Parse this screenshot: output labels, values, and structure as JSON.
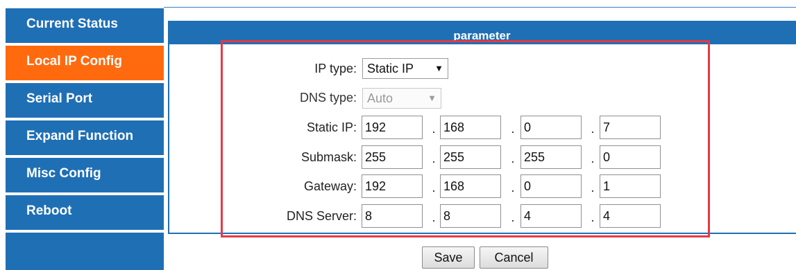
{
  "sidebar": {
    "items": [
      {
        "label": "Current Status"
      },
      {
        "label": "Local IP Config",
        "active": true
      },
      {
        "label": "Serial Port"
      },
      {
        "label": "Expand Function"
      },
      {
        "label": "Misc Config"
      },
      {
        "label": "Reboot"
      }
    ]
  },
  "panel": {
    "title": "parameter",
    "ip_type": {
      "label": "IP type:",
      "value": "Static IP"
    },
    "dns_type": {
      "label": "DNS type:",
      "value": "Auto",
      "disabled": true
    },
    "static_ip": {
      "label": "Static IP:",
      "octets": [
        "192",
        "168",
        "0",
        "7"
      ]
    },
    "submask": {
      "label": "Submask:",
      "octets": [
        "255",
        "255",
        "255",
        "0"
      ]
    },
    "gateway": {
      "label": "Gateway:",
      "octets": [
        "192",
        "168",
        "0",
        "1"
      ]
    },
    "dns_server": {
      "label": "DNS Server:",
      "octets": [
        "8",
        "8",
        "4",
        "4"
      ]
    }
  },
  "actions": {
    "save_label": "Save",
    "cancel_label": "Cancel"
  },
  "colors": {
    "sidebar": "#1f6fb5",
    "active": "#ff6a0f",
    "highlight": "#e53945"
  },
  "icons": {
    "dropdown": "caret-down-icon"
  }
}
